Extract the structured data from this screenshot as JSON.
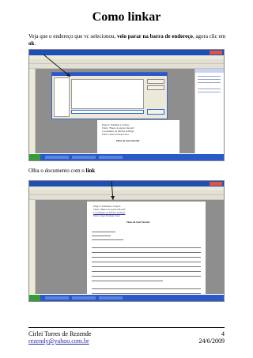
{
  "title": "Como linkar",
  "intro": {
    "text_start": "Veja que o endereço que vc selecionou, ",
    "text_bold": "veio parar na barra de endereço",
    "text_mid": ", agora clic em ",
    "text_ok": "ok",
    "text_end": "."
  },
  "caption2": {
    "text_start": "Olha o documento com o ",
    "text_bold": "link"
  },
  "doc_lines": [
    "Etapa 3: Trabalhar a Criação",
    "Título: \"Banco de Ações Tutorial\"",
    "Coordenador da Oficina de Blogs",
    "Tutor: César Trevisan Cravo"
  ],
  "doc_heading": "Plano de Ação Tutorial",
  "footer": {
    "author": "Cirlei Torres de Rezende",
    "email": "rezendy@yahoo.com.br",
    "page": "4",
    "date": "24/6/2009"
  }
}
